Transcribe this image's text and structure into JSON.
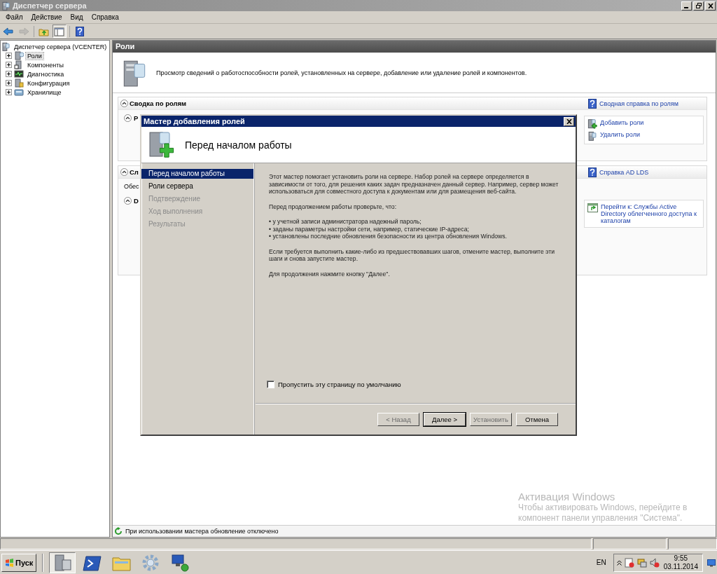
{
  "window": {
    "title": "Диспетчер сервера"
  },
  "menu": [
    "Файл",
    "Действие",
    "Вид",
    "Справка"
  ],
  "toolbar": [
    {
      "kind": "back",
      "disabled": false,
      "pressed": false
    },
    {
      "kind": "forward",
      "disabled": true,
      "pressed": false
    },
    {
      "kind": "folder-up",
      "disabled": false,
      "pressed": false
    },
    {
      "kind": "console-tree",
      "disabled": false,
      "pressed": true
    },
    {
      "kind": "help",
      "disabled": false,
      "pressed": false
    }
  ],
  "tree": {
    "label": "Диспетчер сервера (VCENTER)",
    "selected": false,
    "children": [
      {
        "label": "Роли",
        "kind": "roles",
        "expanded": false,
        "selected": true
      },
      {
        "label": "Компоненты",
        "kind": "features",
        "expanded": false,
        "selected": false
      },
      {
        "label": "Диагностика",
        "kind": "diagnostics",
        "expanded": false,
        "selected": false
      },
      {
        "label": "Конфигурация",
        "kind": "configuration",
        "expanded": false,
        "selected": false
      },
      {
        "label": "Хранилище",
        "kind": "storage",
        "expanded": false,
        "selected": false
      }
    ]
  },
  "content": {
    "header": "Роли",
    "intro": "Просмотр сведений о работоспособности ролей, установленных на сервере, добавление или удаление ролей и компонентов.",
    "sections": [
      {
        "title": "Сводка по ролям",
        "expanded": true,
        "help": "Сводная справка по ролям",
        "body": [
          {
            "kind": "subsection",
            "title": "Р",
            "expanded": true
          }
        ],
        "actions": [
          "Добавить роли",
          "Удалить роли"
        ]
      },
      {
        "title": "Сл",
        "expanded": true,
        "help": "Справка AD LDS",
        "body": [
          {
            "kind": "text",
            "text": "Обес"
          },
          {
            "kind": "subsection",
            "title": "D",
            "expanded": true
          }
        ],
        "actions": [
          "Перейти к: Службы Active Directory облегченного доступа к каталогам"
        ]
      }
    ]
  },
  "status": "При использовании мастера обновление отключено",
  "dialog": {
    "title": "Мастер добавления ролей",
    "heading": "Перед началом работы",
    "steps": [
      {
        "label": "Перед началом работы",
        "selected": true,
        "disabled": false
      },
      {
        "label": "Роли сервера",
        "selected": false,
        "disabled": false
      },
      {
        "label": "Подтверждение",
        "selected": false,
        "disabled": true
      },
      {
        "label": "Ход выполнения",
        "selected": false,
        "disabled": true
      },
      {
        "label": "Результаты",
        "selected": false,
        "disabled": true
      }
    ],
    "blocks": [
      {
        "kind": "paragraph",
        "lines": [
          "Этот мастер помогает установить роли на сервере. Набор ролей на сервере определяется в зависимости от того, для решения каких задач предназначен данный сервер. Например, сервер может использоваться для совместного доступа к документам или для размещения веб-сайта."
        ]
      },
      {
        "kind": "paragraph",
        "lines": [
          "Перед продолжением работы проверьте, что:"
        ]
      },
      {
        "kind": "paragraph",
        "lines": [
          "• у учетной записи администратора надежный пароль;",
          "• заданы параметры настройки сети, например, статические IP-адреса;",
          "• установлены последние обновления безопасности из центра обновления Windows."
        ]
      },
      {
        "kind": "paragraph",
        "lines": [
          "Если требуется выполнить какие-либо из предшествовавших шагов, отмените мастер, выполните эти шаги и снова запустите мастер."
        ]
      },
      {
        "kind": "paragraph",
        "lines": [
          "Для продолжения нажмите кнопку \"Далее\"."
        ]
      }
    ],
    "skip": {
      "label": "Пропустить эту страницу по умолчанию",
      "checked": false
    },
    "buttons": [
      {
        "label": "< Назад",
        "disabled": true,
        "default": false
      },
      {
        "label": "Далее >",
        "disabled": false,
        "default": true
      },
      {
        "label": "Установить",
        "disabled": true,
        "default": false
      },
      {
        "label": "Отмена",
        "disabled": false,
        "default": false
      }
    ]
  },
  "activation": {
    "title": "Активация Windows",
    "text": "Чтобы активировать Windows, перейдите в компонент панели управления \"Система\"."
  },
  "taskbar": {
    "start": "Пуск",
    "language": "EN",
    "time": "9:55",
    "date": "03.11.2014"
  }
}
